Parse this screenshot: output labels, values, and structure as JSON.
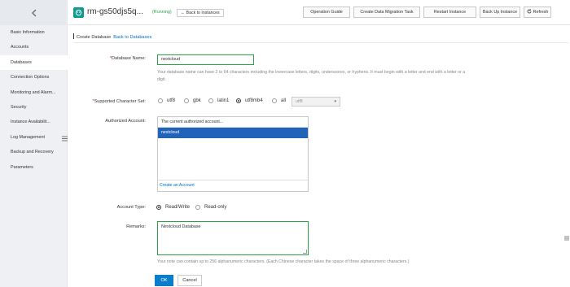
{
  "sidebar": {
    "items": [
      {
        "label": "Basic Information"
      },
      {
        "label": "Accounts"
      },
      {
        "label": "Databases"
      },
      {
        "label": "Connection Options"
      },
      {
        "label": "Monitoring and Alarm..."
      },
      {
        "label": "Security"
      },
      {
        "label": "Instance Availabilit..."
      },
      {
        "label": "Log Management"
      },
      {
        "label": "Backup and Recovery"
      },
      {
        "label": "Parameters"
      }
    ],
    "active_index": 2,
    "back_icon": "chevron-left-icon",
    "collapse_icon": "menu-icon"
  },
  "header": {
    "instance_name": "rm-gs50djs5q...",
    "status": "(Running)",
    "back_to_instances": "Back to Instances",
    "buttons": {
      "operation_guide": "Operation Guide",
      "create_migration": "Create Data Migration Task",
      "restart": "Restart Instance",
      "backup": "Back Up Instance",
      "refresh": "Refresh"
    }
  },
  "breadcrumb": {
    "title": "Create Database",
    "back_link": "Back to Databases"
  },
  "form": {
    "db_name": {
      "label": "Database Name:",
      "required_mark": "*",
      "value": "nextcloud",
      "help": "Your database name can have 2 to 64 characters including the lowercase letters, digits, underscores, or hyphens. It must begin with a letter and end with a letter or a digit."
    },
    "charset": {
      "label": "Supported Character Set:",
      "required_mark": "*",
      "options": [
        "utf8",
        "gbk",
        "latin1",
        "utf8mb4",
        "all"
      ],
      "selected": "utf8mb4",
      "select_value": "utf8"
    },
    "account": {
      "label": "Authorized Account:",
      "header": "The current authorized account...",
      "items": [
        "nextcloud"
      ],
      "create_link": "Create an Account"
    },
    "account_type": {
      "label": "Account Type:",
      "options": [
        "Read/Write",
        "Read-only"
      ],
      "selected": "Read/Write"
    },
    "remarks": {
      "label": "Remarks:",
      "value": "Nextcloud Database",
      "help": "Your note can contain up to 256 alphanumeric characters. (Each Chinese character takes the space of three alphanumeric characters.)"
    },
    "ok_label": "OK",
    "cancel_label": "Cancel"
  },
  "colors": {
    "accent": "#0b7ecb",
    "running": "#2aa345",
    "selected_row": "#1f64b8",
    "required": "#e2302f"
  }
}
